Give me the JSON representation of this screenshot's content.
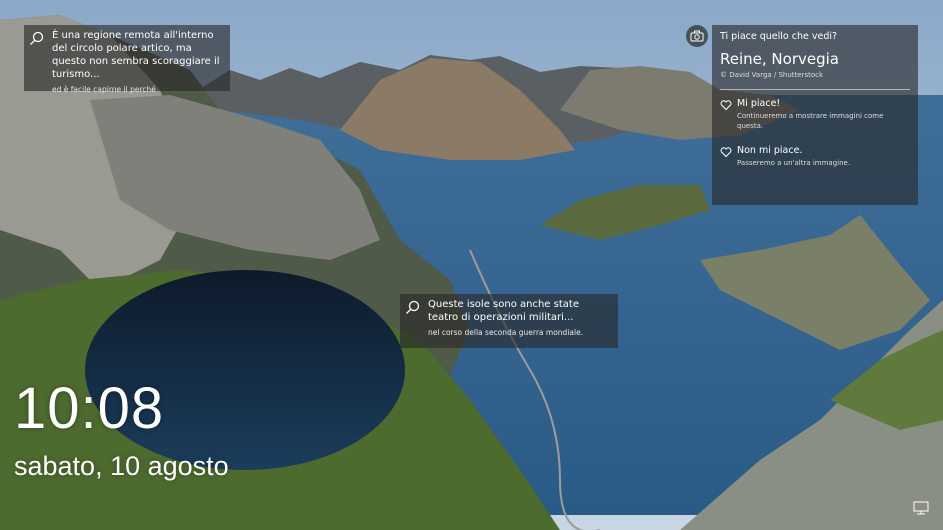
{
  "hotspots": [
    {
      "title": "È una regione remota all'interno del circolo polare artico, ma questo non sembra scoraggiare il turismo...",
      "sub": "ed è facile capirne il perché"
    },
    {
      "title": "Queste isole sono anche state teatro di operazioni militari...",
      "sub": "nel corso della seconda guerra mondiale."
    }
  ],
  "info": {
    "question": "Ti piace quello che vedi?",
    "place": "Reine, Norvegia",
    "credit": "© David Varga / Shutterstock",
    "like_label": "Mi piace!",
    "like_desc": "Continueremo a mostrare immagini come questa.",
    "dislike_label": "Non mi piace.",
    "dislike_desc": "Passeremo a un'altra immagine."
  },
  "clock": {
    "time": "10:08",
    "date": "sabato, 10 agosto"
  },
  "icons": [
    "search-icon",
    "camera-icon",
    "heart-icon",
    "network-icon"
  ]
}
